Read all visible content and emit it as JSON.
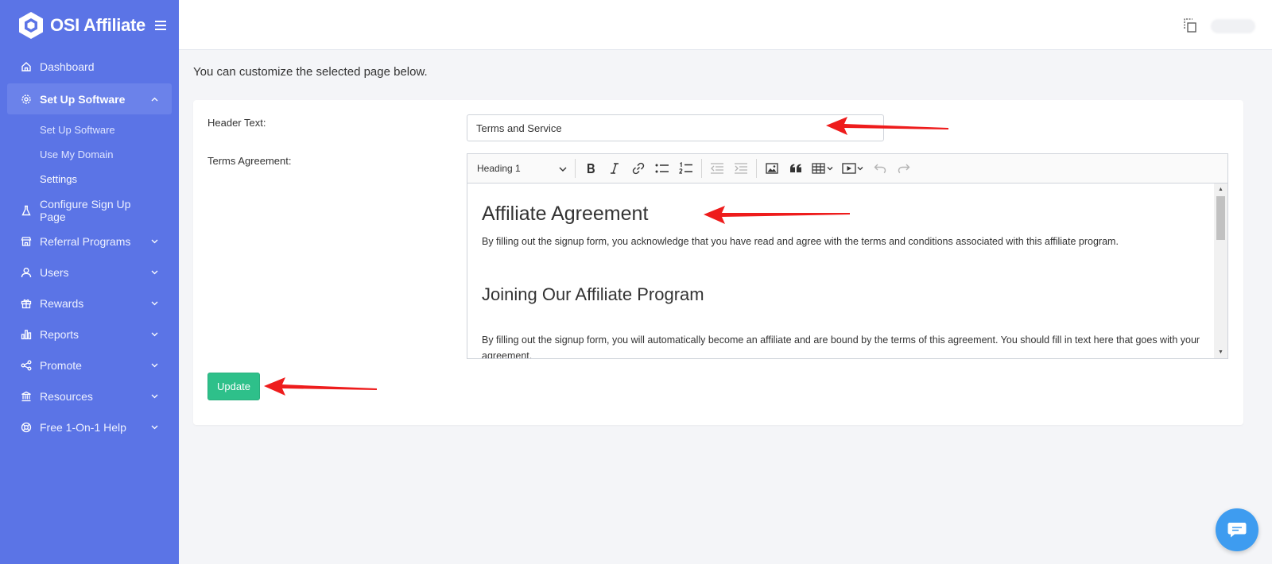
{
  "app": {
    "name": "OSI Affiliate"
  },
  "sidebar": {
    "items": [
      {
        "label": "Dashboard",
        "icon": "home-icon"
      },
      {
        "label": "Set Up Software",
        "icon": "gear-icon",
        "expanded": true,
        "children": [
          {
            "label": "Set Up Software"
          },
          {
            "label": "Use My Domain"
          },
          {
            "label": "Settings",
            "current": true
          }
        ]
      },
      {
        "label": "Configure Sign Up Page",
        "icon": "flask-icon"
      },
      {
        "label": "Referral Programs",
        "icon": "store-icon"
      },
      {
        "label": "Users",
        "icon": "user-icon"
      },
      {
        "label": "Rewards",
        "icon": "gift-icon"
      },
      {
        "label": "Reports",
        "icon": "bar-chart-icon"
      },
      {
        "label": "Promote",
        "icon": "share-icon"
      },
      {
        "label": "Resources",
        "icon": "bank-icon"
      },
      {
        "label": "Free 1-On-1 Help",
        "icon": "lifebuoy-icon"
      }
    ]
  },
  "main": {
    "caption": "You can customize the selected page below.",
    "form": {
      "header_label": "Header Text:",
      "header_value": "Terms and Service",
      "terms_label": "Terms Agreement:",
      "editor": {
        "heading_select": "Heading 1",
        "content": {
          "h1": "Affiliate Agreement",
          "p1": "By filling out the signup form, you acknowledge that you have read and agree with the terms and conditions associated with this affiliate program.",
          "h2": "Joining Our Affiliate Program",
          "p2": "By filling out the signup form, you will automatically become an affiliate and are bound by the terms of this agreement. You should fill in text here that goes with your agreement."
        }
      },
      "update_label": "Update"
    }
  },
  "colors": {
    "sidebar": "#5b74e6",
    "primary_button": "#2ec08a",
    "annotation_arrow": "#ee1c1c",
    "chat_bubble": "#3e9cf0"
  }
}
